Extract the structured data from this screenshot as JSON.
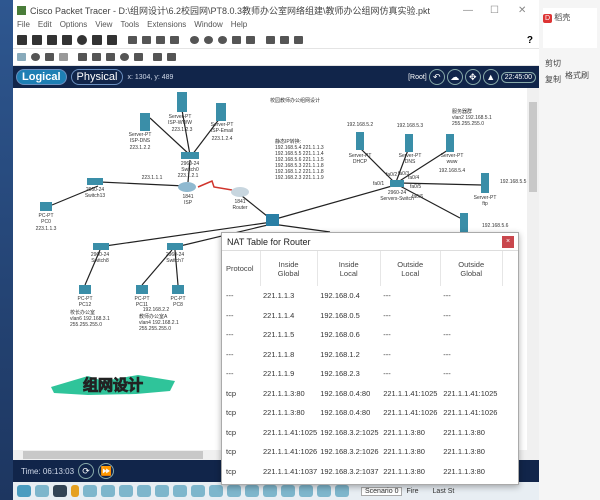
{
  "window": {
    "title": "Cisco Packet Tracer - D:\\组网设计\\6.2校园网\\PT8.0.3教师办公室网络组建\\教师办公组网仿真实验.pkt",
    "min": "—",
    "max": "☐",
    "close": "✕"
  },
  "menu": [
    "File",
    "Edit",
    "Options",
    "View",
    "Tools",
    "Extensions",
    "Window",
    "Help"
  ],
  "help_icon": "?",
  "nav": {
    "logical": "Logical",
    "physical": "Physical",
    "coords": "x: 1304, y: 489",
    "root": "[Root]",
    "clock": "22:45:00"
  },
  "canvas": {
    "title": "校园教师办公组网设计",
    "nat_note": [
      "静态IP转换:",
      "192.168.5.4 221.1.1.3",
      "192.168.5.5 221.1.1.4",
      "192.168.5.6 221.1.1.5",
      "192.168.5.3 221.1.1.8",
      "192.168.1.2 221.1.1.8",
      "192.168.2.3 221.1.1.9"
    ],
    "server_note": [
      "服务器群",
      "vlan2 192.168.5.1",
      "255.255.255.0"
    ],
    "office1_note": [
      "校长办公室",
      "vlan6 192.168.3.1",
      "255.255.255.0"
    ],
    "office2_note": [
      "教师办公室A",
      "vlan4 192.168.2.1",
      "255.255.255.0"
    ],
    "labels": {
      "isp_www": [
        "Server-PT",
        "ISP-WWW",
        "223.1.2.3"
      ],
      "isp_dns": [
        "Server-PT",
        "ISP-DNS",
        "223.1.2.2"
      ],
      "isp_email": [
        "Server-PT",
        "ISP-Email",
        "223.1.2.4"
      ],
      "switch0": [
        "2960-24",
        "Switch0",
        "223.1.2.1"
      ],
      "isp": [
        "1841",
        "ISP"
      ],
      "isp_ip": "223.1.1.1",
      "router": [
        "1841",
        "Router"
      ],
      "switch13": [
        "2960-24",
        "Switch13"
      ],
      "pc0": [
        "PC-PT",
        "PC0",
        "223.1.1.3"
      ],
      "dhcp": [
        "192.168.5.2",
        "Server-PT",
        "DHCP"
      ],
      "dns": [
        "192.168.5.3",
        "Server-PT",
        "DNS"
      ],
      "www": [
        "Server-PT",
        "www",
        "192.168.5.4"
      ],
      "ftp": [
        "Server-PT",
        "ftp",
        "192.168.5.5"
      ],
      "srv6": "192.168.5.6",
      "servers_switch": [
        "2960-24",
        "Servers-Switch"
      ],
      "ports": [
        "fa0/1",
        "fa0/2",
        "fa0/3",
        "fa0/4",
        "fa0/5",
        "fa0/6"
      ],
      "switch8": [
        "2960-24",
        "Switch8"
      ],
      "switch7": [
        "2960-24",
        "Switch7"
      ],
      "pc12": [
        "PC-PT",
        "PC12"
      ],
      "pc11": [
        "PC-PT",
        "PC11",
        "192.168.2.2"
      ],
      "pc8": [
        "PC-PT",
        "PC8"
      ]
    },
    "banner": "组网设计"
  },
  "timebar": {
    "time": "Time: 06:13:03"
  },
  "devbar": {
    "scenario": "Scenario 0",
    "fire": "Fire",
    "last": "Last St"
  },
  "wps": {
    "app": "稻壳",
    "cut": "剪切",
    "copy": "复制",
    "format": "格式刷"
  },
  "nat": {
    "title": "NAT Table for Router",
    "close": "×",
    "headers": [
      [
        "Protocol",
        ""
      ],
      [
        "Inside",
        "Global"
      ],
      [
        "Inside",
        "Local"
      ],
      [
        "Outside",
        "Local"
      ],
      [
        "Outside",
        "Global"
      ]
    ],
    "rows": [
      [
        "---",
        "221.1.1.3",
        "192.168.0.4",
        "---",
        "---"
      ],
      [
        "---",
        "221.1.1.4",
        "192.168.0.5",
        "---",
        "---"
      ],
      [
        "---",
        "221.1.1.5",
        "192.168.0.6",
        "---",
        "---"
      ],
      [
        "---",
        "221.1.1.8",
        "192.168.1.2",
        "---",
        "---"
      ],
      [
        "---",
        "221.1.1.9",
        "192.168.2.3",
        "---",
        "---"
      ],
      [
        "tcp",
        "221.1.1.3:80",
        "192.168.0.4:80",
        "221.1.1.41:1025",
        "221.1.1.41:1025"
      ],
      [
        "tcp",
        "221.1.1.3:80",
        "192.168.0.4:80",
        "221.1.1.41:1026",
        "221.1.1.41:1026"
      ],
      [
        "tcp",
        "221.1.1.41:1025",
        "192.168.3.2:1025",
        "221.1.1.3:80",
        "221.1.1.3:80"
      ],
      [
        "tcp",
        "221.1.1.41:1026",
        "192.168.3.2:1026",
        "221.1.1.3:80",
        "221.1.1.3:80"
      ],
      [
        "tcp",
        "221.1.1.41:1037",
        "192.168.3.2:1037",
        "221.1.1.3:80",
        "221.1.1.3:80"
      ]
    ]
  },
  "colors": {
    "navy": "#11254a",
    "accent": "#1e7fb4",
    "link_wan": "#d0342c",
    "banner": "#2fc49a"
  }
}
